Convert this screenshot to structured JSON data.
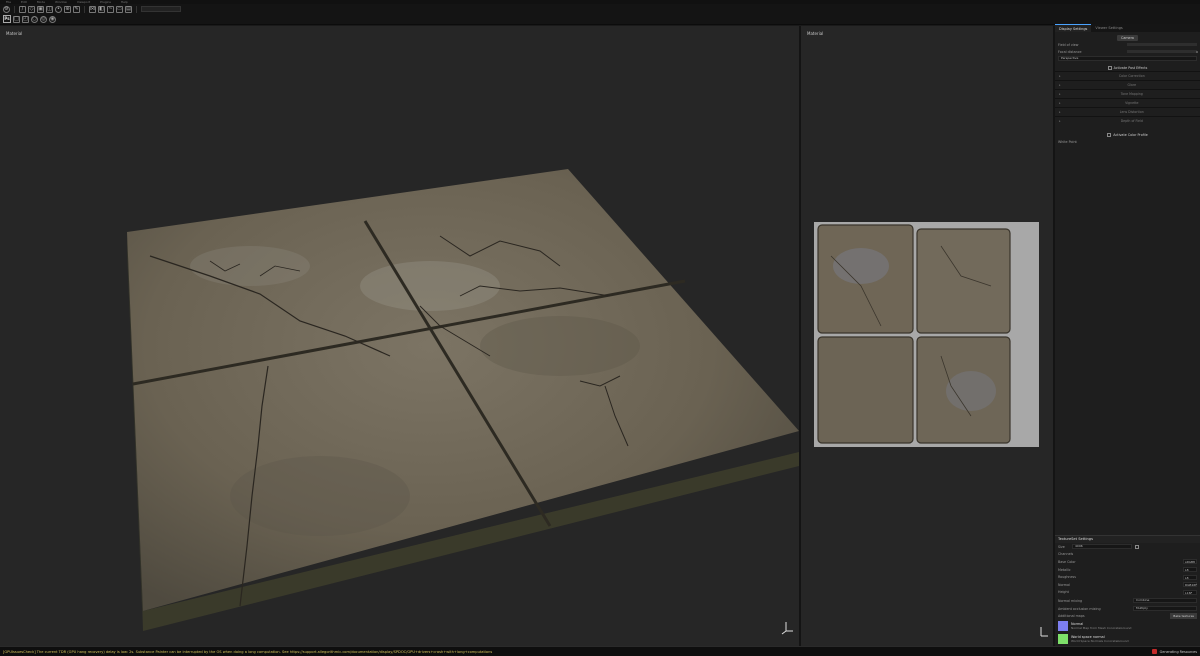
{
  "menu": [
    "File",
    "Edit",
    "Mode",
    "Window",
    "Viewport",
    "Plugins",
    "Help"
  ],
  "viewports": {
    "view3d_label": "Material",
    "view2d_label": "Material"
  },
  "panel": {
    "tabs": [
      "Display Settings",
      "Viewer Settings"
    ],
    "camera_button": "Camera",
    "field_of_view_label": "Field of view",
    "focal_distance_label": "Focal distance",
    "focal_distance_value": "0",
    "projection_value": "Perspective",
    "post_effects_label": "Activate Post Effects",
    "effect_sections": [
      "Color Correction",
      "Glare",
      "Tone Mapping",
      "Vignette",
      "Lens Distortion",
      "Depth of Field"
    ],
    "color_profile_label": "Activate Color Profile",
    "white_point_label": "White Point"
  },
  "textureset": {
    "title": "TextureSet Settings",
    "size_label": "Size",
    "size_value": "4096",
    "channels_label": "Channels",
    "channels": [
      {
        "name": "Base Color",
        "format": "sRGB8"
      },
      {
        "name": "Metallic",
        "format": "L8"
      },
      {
        "name": "Roughness",
        "format": "L8"
      },
      {
        "name": "Normal",
        "format": "RGB16F"
      },
      {
        "name": "Height",
        "format": "L16F"
      }
    ],
    "normal_mixing_label": "Normal mixing",
    "normal_mixing_value": "Combine",
    "ao_mixing_label": "Ambient occlusion mixing",
    "ao_mixing_value": "Multiply",
    "additional_maps_label": "Additional maps",
    "bake_button": "Bake textures",
    "maps": [
      {
        "name": "Normal",
        "desc": "Normal Map from Mesh ConcreteGround",
        "color": "#7d7ef0"
      },
      {
        "name": "World space normal",
        "desc": "World Space Normals ConcreteGround",
        "color": "#7ee06a"
      }
    ]
  },
  "status": {
    "message": "[GPUIssuesCheck] The current TDR (GPU hang recovery) delay is low: 2s. Substance Painter can be interrupted by the OS when doing a long computation. See https://support.allegorithmic.com/documentation/display/SPDOC/GPU+drivers+crash+with+long+computations",
    "task": "Generating Resources"
  },
  "colors": {
    "accent": "#4aa3ff",
    "status_text": "#d3c25c",
    "busy": "#c42a2a"
  }
}
